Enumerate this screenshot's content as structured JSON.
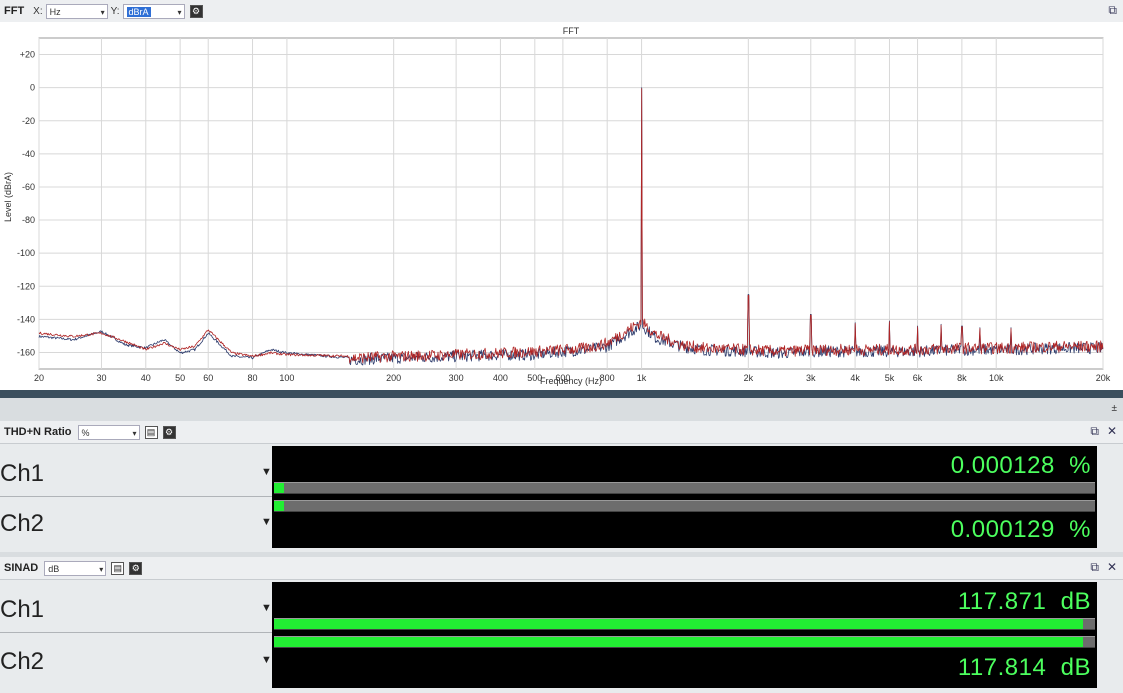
{
  "fft_panel": {
    "title": "FFT",
    "x_label": "X:",
    "x_unit": "Hz",
    "y_label": "Y:",
    "y_unit": "dBrA",
    "popout_icon": "popout-icon",
    "settings_icon": "gear-icon"
  },
  "chart_data": {
    "type": "line",
    "title": "FFT",
    "xlabel": "Frequency (Hz)",
    "ylabel": "Level (dBrA)",
    "xscale": "log",
    "xlim": [
      20,
      20000
    ],
    "ylim": [
      -170,
      30
    ],
    "grid": true,
    "x_ticks": [
      "20",
      "30",
      "40",
      "50",
      "60",
      "80",
      "100",
      "200",
      "300",
      "400",
      "500",
      "600",
      "800",
      "1k",
      "2k",
      "3k",
      "4k",
      "5k",
      "6k",
      "8k",
      "10k",
      "20k"
    ],
    "x_tick_values": [
      20,
      30,
      40,
      50,
      60,
      80,
      100,
      200,
      300,
      400,
      500,
      600,
      800,
      1000,
      2000,
      3000,
      4000,
      5000,
      6000,
      8000,
      10000,
      20000
    ],
    "y_ticks": [
      "+20",
      "0",
      "-20",
      "-40",
      "-60",
      "-80",
      "-100",
      "-120",
      "-140",
      "-160"
    ],
    "y_tick_values": [
      20,
      0,
      -20,
      -40,
      -60,
      -80,
      -100,
      -120,
      -140,
      -160
    ],
    "series": [
      {
        "color": "#2b3a6b",
        "x": [
          20,
          25,
          30,
          35,
          40,
          45,
          50,
          55,
          60,
          70,
          80,
          90,
          100,
          150,
          200,
          300,
          400,
          500,
          600,
          700,
          800,
          900,
          1000,
          1100,
          1300,
          1500,
          2000,
          2500,
          3000,
          3500,
          4000,
          5000,
          6000,
          8000,
          10000,
          15000,
          20000
        ],
        "y": [
          -150,
          -152,
          -147,
          -155,
          -157,
          -152,
          -160,
          -158,
          -148,
          -162,
          -163,
          -158,
          -160,
          -163,
          -162,
          -161,
          -160,
          -160,
          -158,
          -157,
          -155,
          -148,
          -142,
          -150,
          -155,
          -157,
          -158,
          -159,
          -158,
          -158,
          -158,
          -158,
          -158,
          -157,
          -157,
          -156,
          -156
        ]
      },
      {
        "color": "#b02525",
        "x": [
          20,
          25,
          30,
          35,
          40,
          45,
          50,
          55,
          60,
          70,
          80,
          90,
          100,
          150,
          200,
          300,
          400,
          500,
          600,
          700,
          800,
          900,
          1000,
          1100,
          1300,
          1500,
          2000,
          2500,
          3000,
          3500,
          4000,
          5000,
          6000,
          8000,
          10000,
          15000,
          20000
        ],
        "y": [
          -148,
          -150,
          -148,
          -153,
          -158,
          -154,
          -158,
          -156,
          -146,
          -160,
          -162,
          -160,
          -161,
          -162,
          -161,
          -160,
          -159,
          -158,
          -157,
          -156,
          -153,
          -146,
          -140,
          -148,
          -154,
          -156,
          -157,
          -158,
          -157,
          -157,
          -157,
          -157,
          -157,
          -156,
          -156,
          -155,
          -155
        ]
      }
    ],
    "peaks": [
      {
        "x": 1000,
        "y": 0
      },
      {
        "x": 2000,
        "y": -125
      },
      {
        "x": 3000,
        "y": -137
      },
      {
        "x": 4000,
        "y": -142
      },
      {
        "x": 5000,
        "y": -141
      },
      {
        "x": 6000,
        "y": -144
      },
      {
        "x": 7000,
        "y": -143
      },
      {
        "x": 8000,
        "y": -144
      },
      {
        "x": 9000,
        "y": -145
      },
      {
        "x": 11000,
        "y": -145
      }
    ]
  },
  "thdn_panel": {
    "title": "THD+N Ratio",
    "unit": "%",
    "channels": [
      {
        "name": "Ch1",
        "value": "0.000128",
        "unit": "%",
        "level": 0.01
      },
      {
        "name": "Ch2",
        "value": "0.000129",
        "unit": "%",
        "level": 0.01
      }
    ]
  },
  "sinad_panel": {
    "title": "SINAD",
    "unit": "dB",
    "channels": [
      {
        "name": "Ch1",
        "value": "117.871",
        "unit": "dB",
        "level": 0.985
      },
      {
        "name": "Ch2",
        "value": "117.814",
        "unit": "dB",
        "level": 0.985
      }
    ]
  },
  "colors": {
    "meter_green": "#22ee33",
    "readout_green": "#4cff5e",
    "trace_blue": "#2b3a6b",
    "trace_red": "#b02525"
  }
}
